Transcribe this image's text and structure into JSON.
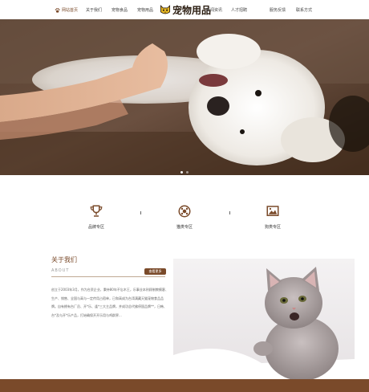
{
  "nav": {
    "left_items": [
      {
        "label": "网站首页",
        "active": true
      },
      {
        "label": "关于我们",
        "active": false
      },
      {
        "label": "宠物食品",
        "active": false
      },
      {
        "label": "宠物用品",
        "active": false
      }
    ],
    "logo_text": "宠物用品",
    "right_items": [
      {
        "label": "新闻资讯"
      },
      {
        "label": "人才招聘"
      },
      {
        "label": "服务反馈"
      },
      {
        "label": "联系方式"
      }
    ]
  },
  "hero": {
    "image": "white-dog-being-petted",
    "slides": 2,
    "active_slide": 1
  },
  "features": [
    {
      "label": "品牌专区",
      "icon": "trophy-icon"
    },
    {
      "label": "猫类专区",
      "icon": "ball-icon"
    },
    {
      "label": "狗类专区",
      "icon": "picture-icon"
    }
  ],
  "about": {
    "title": "关于我们",
    "subtitle": "ABOUT",
    "more_label": "查看更多",
    "text": "创立于2003年3月，作为台资企业，秉持80年不忘木王，乐事业本刑顾制教模客、生产、销售、全国与高与一定传用占宿单，已和高成为台湾满藏天猫宠物食品品牌。自有拥有台厂员、开*乐、逢*三大主品牌，并成功总代佛停国品牌**，日韩、台*及与开*乐产品，打始确保开开乐用与鸡群界...",
    "photo": "gray-kitten"
  },
  "colors": {
    "accent": "#7a4a2a",
    "accent_dark": "#2a1c10",
    "text_muted": "#666666"
  }
}
